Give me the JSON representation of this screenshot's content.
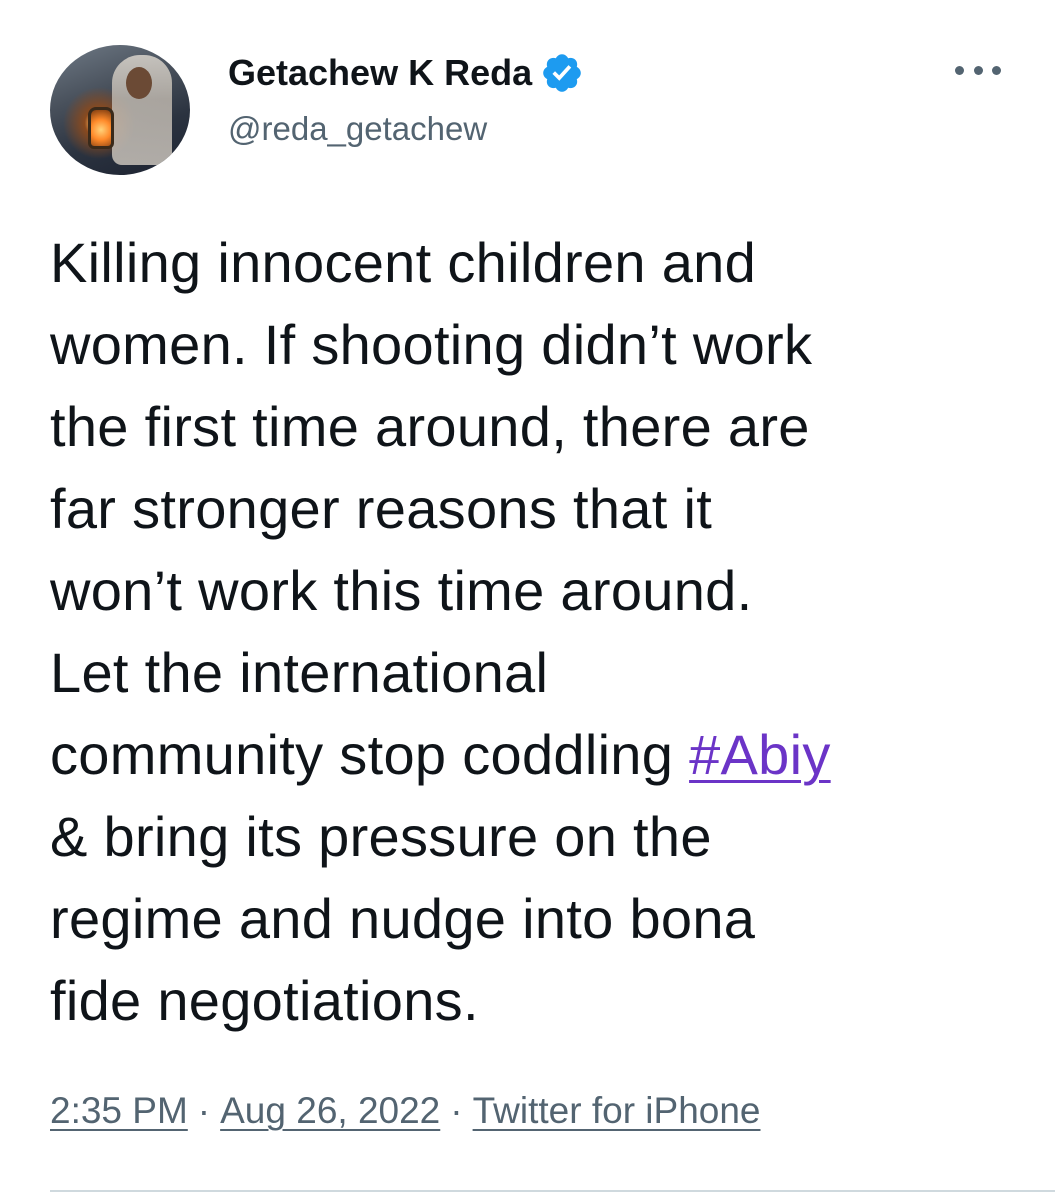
{
  "author": {
    "display_name": "Getachew K Reda",
    "handle": "@reda_getachew",
    "verified": true,
    "verified_color": "#1d9bf0"
  },
  "tweet": {
    "lines": [
      "Killing innocent children and",
      "women. If shooting didn’t work",
      "the first time around, there are",
      "far stronger reasons that it",
      "won’t work this time around.",
      "Let the international",
      "community stop coddling ",
      "& bring its pressure on the",
      "regime and nudge into bona",
      "fide negotiations."
    ],
    "hashtag": "#Abiy",
    "hashtag_color": "#6b34c7"
  },
  "meta": {
    "time": "2:35 PM",
    "date": "Aug 26, 2022",
    "separator": "·",
    "source": "Twitter for iPhone"
  },
  "icons": {
    "more": "more-options-icon",
    "verified": "verified-badge-icon"
  }
}
